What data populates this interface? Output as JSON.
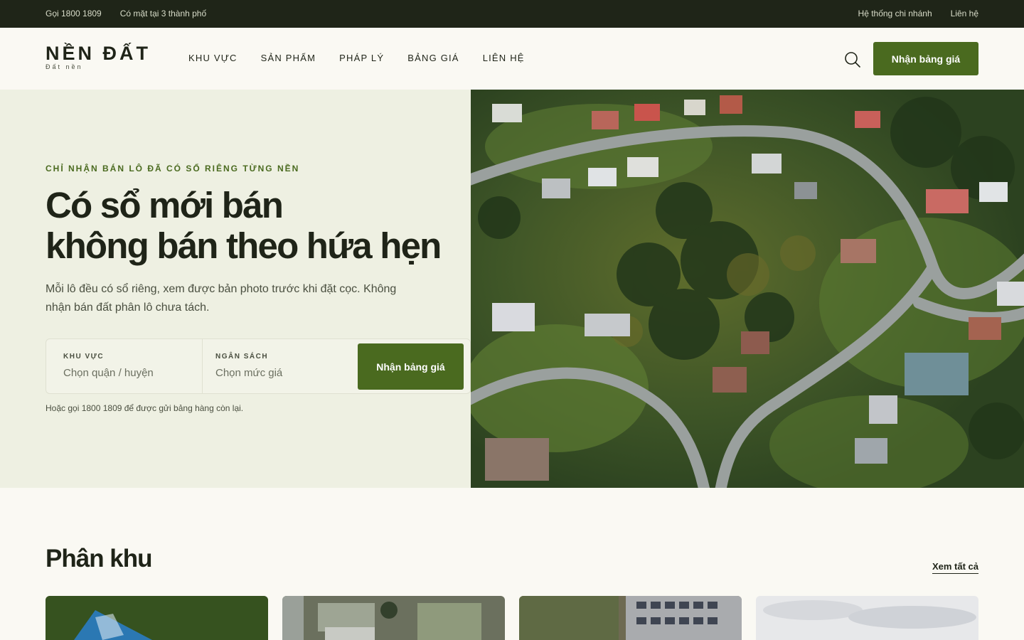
{
  "topbar": {
    "phone": "Gọi 1800 1809",
    "cities": "Có mặt tại 3 thành phố",
    "branches": "Hệ thống chi nhánh",
    "contact": "Liên hệ"
  },
  "header": {
    "logo_title": "NỀN ĐẤT",
    "logo_sub": "Đất nền",
    "nav": [
      "KHU VỰC",
      "SẢN PHẨM",
      "PHÁP LÝ",
      "BẢNG GIÁ",
      "LIÊN HỆ"
    ],
    "search_icon": "search-icon",
    "cta": "Nhận bảng giá"
  },
  "hero": {
    "eyebrow": "CHỈ NHẬN BÁN LÔ ĐÃ CÓ SỔ RIÊNG TỪNG NỀN",
    "headline_line1": "Có sổ mới bán",
    "headline_line2": "không bán theo hứa hẹn",
    "lead": "Mỗi lô đều có sổ riêng, xem được bản photo trước khi đặt cọc. Không nhận bán đất phân lô chưa tách.",
    "form": {
      "area_label": "KHU VỰC",
      "area_value": "Chọn quận / huyện",
      "budget_label": "NGÂN SÁCH",
      "budget_value": "Chọn mức giá",
      "submit": "Nhận bảng giá"
    },
    "note": "Hoặc gọi 1800 1809 để được gửi bảng hàng còn lại.",
    "image": "aerial-neighborhood-photo"
  },
  "section": {
    "title": "Phân khu",
    "see_all": "Xem tất cả",
    "cards": [
      "blueprint-on-grass-photo",
      "aerial-houses-photo",
      "aerial-town-photo",
      "cloudy-sky-photo"
    ]
  },
  "colors": {
    "topbar_bg": "#1f2518",
    "brand_green": "#4a6a1f",
    "hero_bg": "#eef0e2",
    "page_bg": "#faf9f3"
  }
}
